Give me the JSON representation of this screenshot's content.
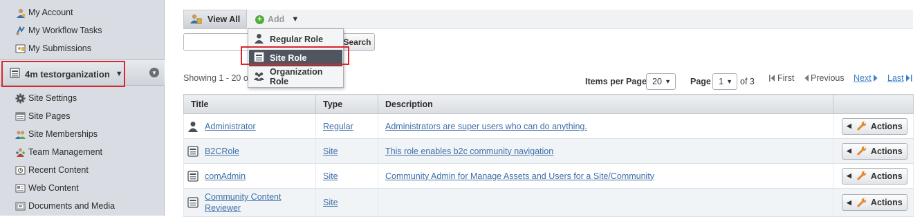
{
  "sidebar": {
    "top_items": [
      {
        "label": "My Account",
        "icon": "account-icon"
      },
      {
        "label": "My Workflow Tasks",
        "icon": "workflow-icon"
      },
      {
        "label": "My Submissions",
        "icon": "submissions-icon"
      }
    ],
    "org_name": "4m testorganization",
    "site_items": [
      {
        "label": "Site Settings",
        "icon": "gear-icon"
      },
      {
        "label": "Site Pages",
        "icon": "pages-icon"
      },
      {
        "label": "Site Memberships",
        "icon": "memberships-icon"
      },
      {
        "label": "Team Management",
        "icon": "team-icon"
      },
      {
        "label": "Recent Content",
        "icon": "recent-content-icon"
      },
      {
        "label": "Web Content",
        "icon": "web-content-icon"
      },
      {
        "label": "Documents and Media",
        "icon": "documents-icon"
      }
    ]
  },
  "toolbar": {
    "view_all_label": "View All",
    "add_label": "Add"
  },
  "add_menu": {
    "items": [
      {
        "label": "Regular Role",
        "icon": "user-icon"
      },
      {
        "label": "Site Role",
        "icon": "site-role-icon",
        "active": true
      },
      {
        "label": "Organization Role",
        "icon": "organization-icon"
      }
    ]
  },
  "search": {
    "value": "",
    "placeholder": "",
    "button_label": "Search"
  },
  "pagination": {
    "showing_text": "Showing 1 - 20 of",
    "items_per_page_label": "Items per Page",
    "items_per_page": "20",
    "page_label": "Page",
    "page": "1",
    "of_pages": "of 3",
    "first": "First",
    "previous": "Previous",
    "next": "Next",
    "last": "Last"
  },
  "table": {
    "headers": [
      "Title",
      "Type",
      "Description",
      ""
    ],
    "rows": [
      {
        "title": "Administrator",
        "type": "Regular",
        "description": "Administrators are super users who can do anything.",
        "icon": "user-icon",
        "action": "Actions"
      },
      {
        "title": "B2CRole",
        "type": "Site",
        "description": "This role enables b2c community navigation",
        "icon": "site-role-icon",
        "action": "Actions"
      },
      {
        "title": "comAdmin",
        "type": "Site",
        "description": "Community Admin for Manage Assets and Users for a Site/Community",
        "icon": "site-role-icon",
        "action": "Actions"
      },
      {
        "title": "Community Content Reviewer",
        "type": "Site",
        "description": "",
        "icon": "site-role-icon",
        "action": "Actions"
      }
    ]
  },
  "colors": {
    "highlight": "#d9252b",
    "link": "#3e6fa8",
    "sidebar_bg": "#d9dde3",
    "menu_active": "#4f5660"
  }
}
